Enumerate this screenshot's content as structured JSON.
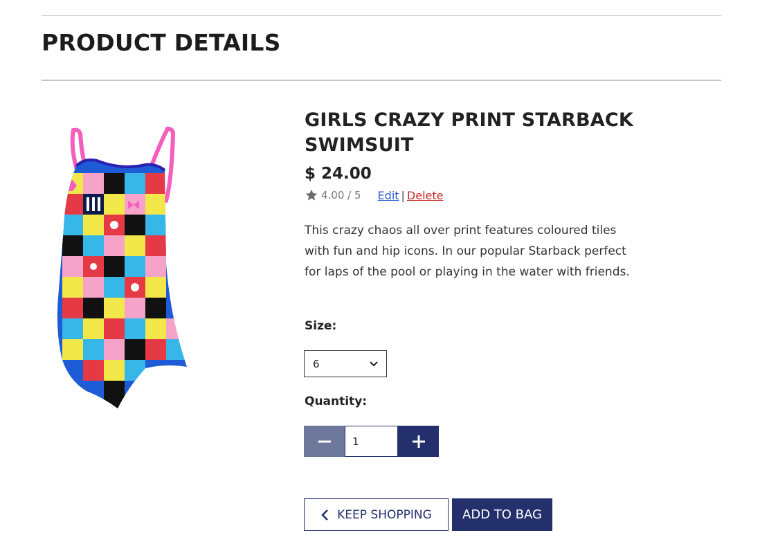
{
  "header": {
    "title": "PRODUCT DETAILS"
  },
  "product": {
    "name": "GIRLS CRAZY PRINT STARBACK SWIMSUIT",
    "price": "$ 24.00",
    "rating": "4.00 / 5",
    "edit_label": "Edit",
    "separator": "|",
    "delete_label": "Delete",
    "description": "This crazy chaos all over print features coloured tiles with fun and hip icons. In our popular Starback perfect for laps of the pool or playing in the water with friends."
  },
  "size": {
    "label": "Size:",
    "selected": "6"
  },
  "quantity": {
    "label": "Quantity:",
    "value": "1",
    "minus_icon": "minus-icon",
    "plus_icon": "plus-icon"
  },
  "actions": {
    "keep_shopping": "KEEP SHOPPING",
    "add_to_bag": "ADD TO BAG"
  },
  "colors": {
    "navy": "#23306b",
    "muted_navy": "#6c7799",
    "link_blue": "#2a5bd7",
    "link_red": "#c62828"
  }
}
